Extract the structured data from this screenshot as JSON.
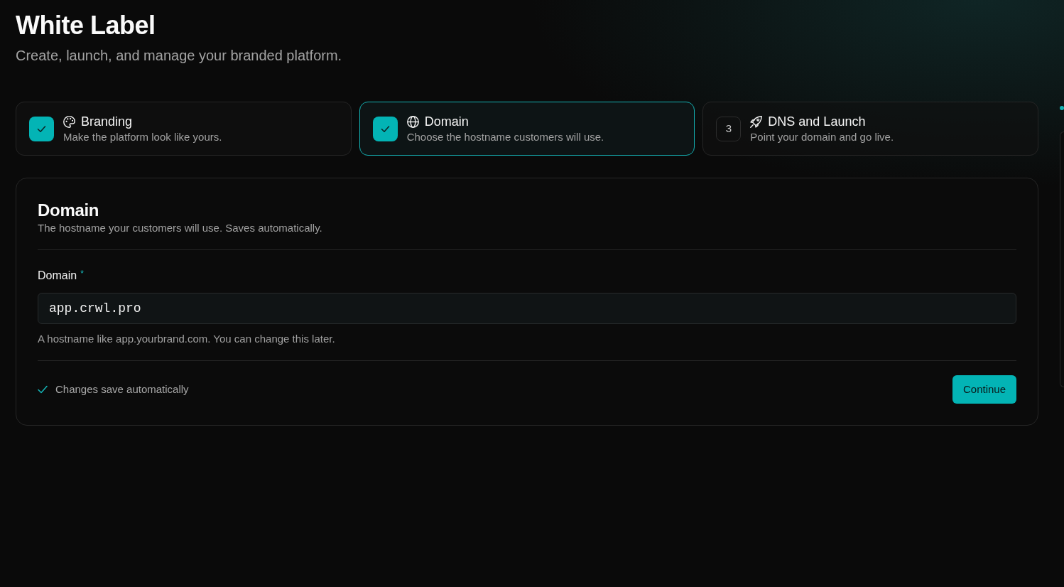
{
  "page": {
    "title": "White Label",
    "subtitle": "Create, launch, and manage your branded platform."
  },
  "steps": [
    {
      "title": "Branding",
      "description": "Make the platform look like yours.",
      "completed": true,
      "selected": false
    },
    {
      "title": "Domain",
      "description": "Choose the hostname customers will use.",
      "completed": true,
      "selected": true
    },
    {
      "number": "3",
      "title": "DNS and Launch",
      "description": "Point your domain and go live.",
      "completed": false,
      "selected": false
    }
  ],
  "form": {
    "title": "Domain",
    "subtitle": "The hostname your customers will use. Saves automatically.",
    "field": {
      "label": "Domain",
      "required_mark": "*",
      "value": "app.crwl.pro",
      "help": "A hostname like app.yourbrand.com. You can change this later."
    },
    "status": "Changes save automatically",
    "button": "Continue"
  }
}
